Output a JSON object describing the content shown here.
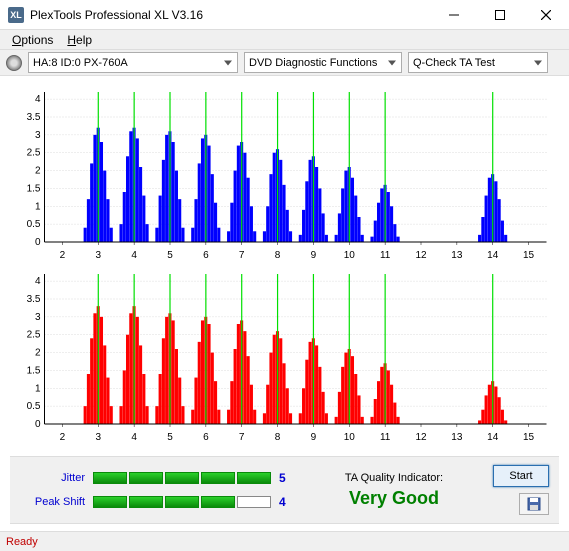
{
  "window": {
    "title": "PlexTools Professional XL V3.16"
  },
  "menu": {
    "options": "Options",
    "help": "Help"
  },
  "toolbar": {
    "drive": "HA:8 ID:0   PX-760A",
    "function": "DVD Diagnostic Functions",
    "test": "Q-Check TA Test"
  },
  "chart_data": [
    {
      "type": "bar",
      "color": "#0000ff",
      "xlim": [
        1.5,
        15.5
      ],
      "ylim": [
        0,
        4.2
      ],
      "yticks": [
        0,
        0.5,
        1,
        1.5,
        2,
        2.5,
        3,
        3.5,
        4
      ],
      "xticks": [
        2,
        3,
        4,
        5,
        6,
        7,
        8,
        9,
        10,
        11,
        12,
        13,
        14,
        15
      ],
      "xticklabels": [
        "2",
        "3",
        "4",
        "5",
        "6",
        "7",
        "8",
        "9",
        "10",
        "11",
        "12",
        "13",
        "14",
        "15"
      ],
      "yticklabels": [
        "0",
        "0.5",
        "1",
        "1.5",
        "2",
        "2.5",
        "3",
        "3.5",
        "4"
      ],
      "markers": [
        3,
        4,
        5,
        6,
        7,
        8,
        9,
        10,
        11,
        14
      ],
      "clusters": [
        {
          "c": 3,
          "v": [
            0.4,
            1.2,
            2.2,
            3.0,
            3.2,
            2.8,
            2.0,
            1.2,
            0.4
          ]
        },
        {
          "c": 4,
          "v": [
            0.5,
            1.4,
            2.4,
            3.1,
            3.2,
            2.9,
            2.1,
            1.3,
            0.5
          ]
        },
        {
          "c": 5,
          "v": [
            0.4,
            1.3,
            2.3,
            3.0,
            3.1,
            2.8,
            2.0,
            1.2,
            0.4
          ]
        },
        {
          "c": 6,
          "v": [
            0.4,
            1.2,
            2.2,
            2.9,
            3.0,
            2.7,
            1.9,
            1.1,
            0.4
          ]
        },
        {
          "c": 7,
          "v": [
            0.3,
            1.1,
            2.0,
            2.7,
            2.8,
            2.5,
            1.8,
            1.0,
            0.3
          ]
        },
        {
          "c": 8,
          "v": [
            0.3,
            1.0,
            1.9,
            2.5,
            2.6,
            2.3,
            1.6,
            0.9,
            0.3
          ]
        },
        {
          "c": 9,
          "v": [
            0.2,
            0.9,
            1.7,
            2.3,
            2.4,
            2.1,
            1.5,
            0.8,
            0.2
          ]
        },
        {
          "c": 10,
          "v": [
            0.2,
            0.8,
            1.5,
            2.0,
            2.1,
            1.8,
            1.3,
            0.7,
            0.2
          ]
        },
        {
          "c": 11,
          "v": [
            0.15,
            0.6,
            1.1,
            1.5,
            1.6,
            1.4,
            1.0,
            0.5,
            0.15
          ]
        },
        {
          "c": 14,
          "v": [
            0.2,
            0.7,
            1.3,
            1.8,
            1.9,
            1.7,
            1.2,
            0.6,
            0.2
          ]
        }
      ]
    },
    {
      "type": "bar",
      "color": "#ff0000",
      "xlim": [
        1.5,
        15.5
      ],
      "ylim": [
        0,
        4.2
      ],
      "yticks": [
        0,
        0.5,
        1,
        1.5,
        2,
        2.5,
        3,
        3.5,
        4
      ],
      "xticks": [
        2,
        3,
        4,
        5,
        6,
        7,
        8,
        9,
        10,
        11,
        12,
        13,
        14,
        15
      ],
      "xticklabels": [
        "2",
        "3",
        "4",
        "5",
        "6",
        "7",
        "8",
        "9",
        "10",
        "11",
        "12",
        "13",
        "14",
        "15"
      ],
      "yticklabels": [
        "0",
        "0.5",
        "1",
        "1.5",
        "2",
        "2.5",
        "3",
        "3.5",
        "4"
      ],
      "markers": [
        3,
        4,
        5,
        6,
        7,
        8,
        9,
        10,
        11,
        14
      ],
      "clusters": [
        {
          "c": 3,
          "v": [
            0.5,
            1.4,
            2.4,
            3.1,
            3.3,
            3.0,
            2.2,
            1.3,
            0.5
          ]
        },
        {
          "c": 4,
          "v": [
            0.5,
            1.5,
            2.5,
            3.1,
            3.3,
            3.0,
            2.2,
            1.4,
            0.5
          ]
        },
        {
          "c": 5,
          "v": [
            0.5,
            1.4,
            2.4,
            3.0,
            3.1,
            2.9,
            2.1,
            1.3,
            0.5
          ]
        },
        {
          "c": 6,
          "v": [
            0.4,
            1.3,
            2.3,
            2.9,
            3.0,
            2.8,
            2.0,
            1.2,
            0.4
          ]
        },
        {
          "c": 7,
          "v": [
            0.4,
            1.2,
            2.1,
            2.8,
            2.9,
            2.6,
            1.9,
            1.1,
            0.4
          ]
        },
        {
          "c": 8,
          "v": [
            0.3,
            1.1,
            2.0,
            2.5,
            2.6,
            2.4,
            1.7,
            1.0,
            0.3
          ]
        },
        {
          "c": 9,
          "v": [
            0.3,
            1.0,
            1.8,
            2.3,
            2.4,
            2.2,
            1.6,
            0.9,
            0.3
          ]
        },
        {
          "c": 10,
          "v": [
            0.2,
            0.9,
            1.6,
            2.0,
            2.1,
            1.9,
            1.4,
            0.8,
            0.2
          ]
        },
        {
          "c": 11,
          "v": [
            0.2,
            0.7,
            1.2,
            1.6,
            1.7,
            1.5,
            1.1,
            0.6,
            0.2
          ]
        },
        {
          "c": 14,
          "v": [
            0.1,
            0.4,
            0.8,
            1.1,
            1.2,
            1.05,
            0.75,
            0.4,
            0.1
          ]
        }
      ]
    }
  ],
  "metrics": {
    "jitter_label": "Jitter",
    "jitter_value": "5",
    "jitter_filled": 5,
    "peak_label": "Peak Shift",
    "peak_value": "4",
    "peak_filled": 4
  },
  "quality": {
    "label": "TA Quality Indicator:",
    "value": "Very Good"
  },
  "buttons": {
    "start": "Start"
  },
  "status": "Ready"
}
